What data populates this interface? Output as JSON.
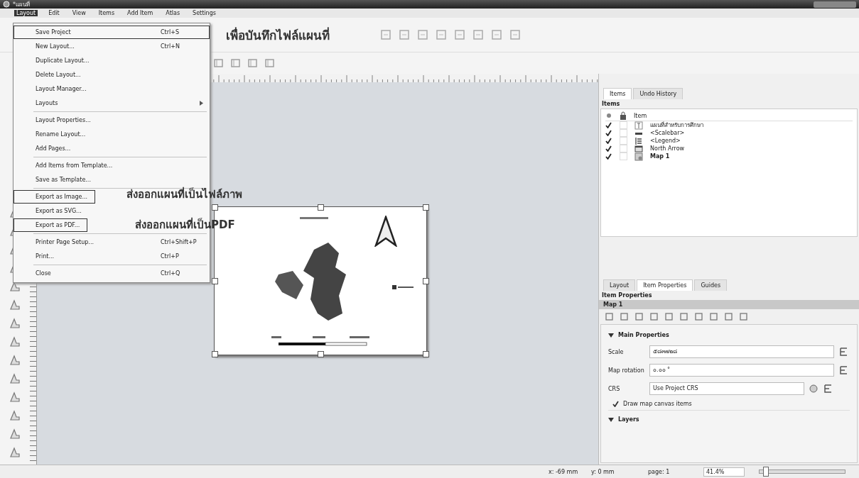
{
  "window": {
    "title": "*แผนที่"
  },
  "menubar": [
    {
      "label": "Layout",
      "selected": true
    },
    {
      "label": "Edit",
      "selected": false
    },
    {
      "label": "View",
      "selected": false
    },
    {
      "label": "Items",
      "selected": false
    },
    {
      "label": "Add Item",
      "selected": false
    },
    {
      "label": "Atlas",
      "selected": false
    },
    {
      "label": "Settings",
      "selected": false
    }
  ],
  "menu": [
    {
      "label": "Save Project",
      "shortcut": "Ctrl+S",
      "marked": true,
      "divider_after": false,
      "submenu": false
    },
    {
      "label": "New Layout...",
      "shortcut": "Ctrl+N",
      "marked": false,
      "divider_after": false,
      "submenu": false
    },
    {
      "label": "Duplicate Layout...",
      "marked": false,
      "divider_after": false,
      "submenu": false
    },
    {
      "label": "Delete Layout...",
      "marked": false,
      "divider_after": false,
      "submenu": false
    },
    {
      "label": "Layout Manager...",
      "marked": false,
      "divider_after": false,
      "submenu": false
    },
    {
      "label": "Layouts",
      "marked": false,
      "divider_after": true,
      "submenu": true
    },
    {
      "label": "Layout Properties...",
      "marked": false,
      "divider_after": false,
      "submenu": false
    },
    {
      "label": "Rename Layout...",
      "marked": false,
      "divider_after": false,
      "submenu": false
    },
    {
      "label": "Add Pages...",
      "marked": false,
      "divider_after": true,
      "submenu": false
    },
    {
      "label": "Add Items from Template...",
      "marked": false,
      "divider_after": false,
      "submenu": false
    },
    {
      "label": "Save as Template...",
      "marked": false,
      "divider_after": true,
      "submenu": false
    },
    {
      "label": "Export as Image...",
      "marked": true,
      "divider_after": false,
      "submenu": false
    },
    {
      "label": "Export as SVG...",
      "marked": false,
      "divider_after": false,
      "submenu": false
    },
    {
      "label": "Export as PDF...",
      "marked": true,
      "divider_after": true,
      "submenu": false
    },
    {
      "label": "Printer Page Setup...",
      "shortcut": "Ctrl+Shift+P",
      "marked": false,
      "divider_after": false,
      "submenu": false
    },
    {
      "label": "Print...",
      "shortcut": "Ctrl+P",
      "marked": false,
      "divider_after": true,
      "submenu": false
    },
    {
      "label": "Close",
      "shortcut": "Ctrl+Q",
      "marked": false,
      "divider_after": false,
      "submenu": false
    }
  ],
  "annotations": [
    "เพื่อบันทึกไฟล์แผนที่",
    "ส่งออกแผนที่เป็นไฟล์ภาพ",
    "ส่งออกแผนที่เป็นPDF"
  ],
  "items_panel": {
    "tabs": [
      {
        "label": "Items",
        "selected": true
      },
      {
        "label": "Undo History",
        "selected": false
      }
    ],
    "title": "Items",
    "column": "Item",
    "rows": [
      {
        "kind": "label",
        "label": "แผนที่สำหรับการศึกษา",
        "visible": true,
        "locked": false,
        "selected": false
      },
      {
        "kind": "scalebar",
        "label": "<Scalebar>",
        "visible": true,
        "locked": false,
        "selected": false
      },
      {
        "kind": "legend",
        "label": "<Legend>",
        "visible": true,
        "locked": false,
        "selected": false
      },
      {
        "kind": "picture",
        "label": "North Arrow",
        "visible": true,
        "locked": false,
        "selected": false
      },
      {
        "kind": "map",
        "label": "Map 1",
        "visible": true,
        "locked": false,
        "selected": true
      }
    ]
  },
  "properties_panel": {
    "tabs": [
      {
        "label": "Layout",
        "selected": false
      },
      {
        "label": "Item Properties",
        "selected": true
      },
      {
        "label": "Guides",
        "selected": false
      }
    ],
    "title": "Item Properties",
    "item": "Map 1",
    "section": {
      "label": "Main Properties",
      "expanded": true
    },
    "scale_label": "Scale",
    "scale": "๕๘๓๗๒๘",
    "rotation_label": "Map rotation",
    "rotation": "๐.๐๐ °",
    "crs_label": "CRS",
    "crs": "Use Project CRS",
    "draw_items": {
      "label": "Draw map canvas items",
      "checked": true
    },
    "layers": {
      "label": "Layers",
      "expanded": true
    }
  },
  "status_bar": {
    "x": "x: -69 mm",
    "y": "y: 0 mm",
    "page": "page: 1",
    "zoom": "41.4%",
    "zoom_slider": {
      "level": 0.04
    }
  }
}
